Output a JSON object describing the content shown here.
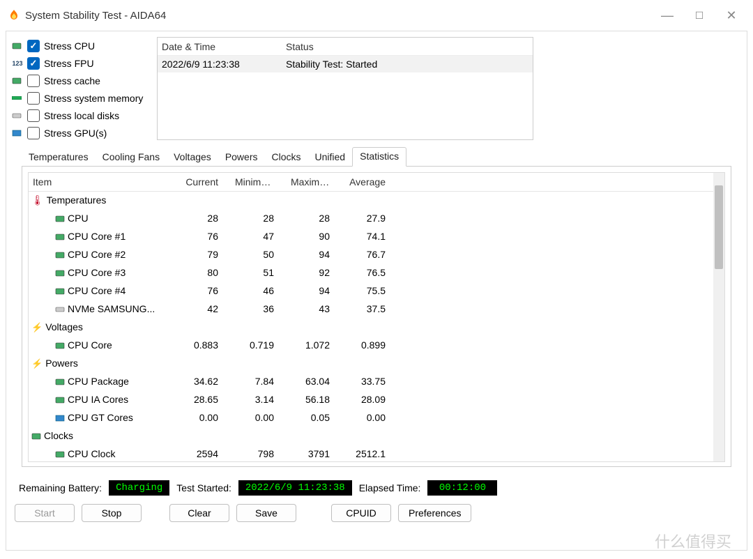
{
  "window": {
    "title": "System Stability Test - AIDA64"
  },
  "stress": [
    {
      "label": "Stress CPU",
      "checked": true,
      "icon": "chip"
    },
    {
      "label": "Stress FPU",
      "checked": true,
      "icon": "fpu"
    },
    {
      "label": "Stress cache",
      "checked": false,
      "icon": "chip"
    },
    {
      "label": "Stress system memory",
      "checked": false,
      "icon": "ram"
    },
    {
      "label": "Stress local disks",
      "checked": false,
      "icon": "disk"
    },
    {
      "label": "Stress GPU(s)",
      "checked": false,
      "icon": "gpu"
    }
  ],
  "log": {
    "headers": {
      "datetime": "Date & Time",
      "status": "Status"
    },
    "rows": [
      {
        "datetime": "2022/6/9 11:23:38",
        "status": "Stability Test: Started"
      }
    ]
  },
  "tabs": [
    "Temperatures",
    "Cooling Fans",
    "Voltages",
    "Powers",
    "Clocks",
    "Unified",
    "Statistics"
  ],
  "active_tab": "Statistics",
  "stats": {
    "headers": {
      "item": "Item",
      "current": "Current",
      "min": "Minimum",
      "max": "Maximu...",
      "avg": "Average"
    },
    "groups": [
      {
        "name": "Temperatures",
        "icon": "therm",
        "rows": [
          {
            "name": "CPU",
            "current": "28",
            "min": "28",
            "max": "28",
            "avg": "27.9",
            "icon": "chip"
          },
          {
            "name": "CPU Core #1",
            "current": "76",
            "min": "47",
            "max": "90",
            "avg": "74.1",
            "icon": "chip"
          },
          {
            "name": "CPU Core #2",
            "current": "79",
            "min": "50",
            "max": "94",
            "avg": "76.7",
            "icon": "chip"
          },
          {
            "name": "CPU Core #3",
            "current": "80",
            "min": "51",
            "max": "92",
            "avg": "76.5",
            "icon": "chip"
          },
          {
            "name": "CPU Core #4",
            "current": "76",
            "min": "46",
            "max": "94",
            "avg": "75.5",
            "icon": "chip"
          },
          {
            "name": "NVMe SAMSUNG...",
            "current": "42",
            "min": "36",
            "max": "43",
            "avg": "37.5",
            "icon": "disk"
          }
        ]
      },
      {
        "name": "Voltages",
        "icon": "bolt",
        "rows": [
          {
            "name": "CPU Core",
            "current": "0.883",
            "min": "0.719",
            "max": "1.072",
            "avg": "0.899",
            "icon": "chip"
          }
        ]
      },
      {
        "name": "Powers",
        "icon": "bolt",
        "rows": [
          {
            "name": "CPU Package",
            "current": "34.62",
            "min": "7.84",
            "max": "63.04",
            "avg": "33.75",
            "icon": "chip"
          },
          {
            "name": "CPU IA Cores",
            "current": "28.65",
            "min": "3.14",
            "max": "56.18",
            "avg": "28.09",
            "icon": "chip"
          },
          {
            "name": "CPU GT Cores",
            "current": "0.00",
            "min": "0.00",
            "max": "0.05",
            "avg": "0.00",
            "icon": "gpu"
          }
        ]
      },
      {
        "name": "Clocks",
        "icon": "chip",
        "rows": [
          {
            "name": "CPU Clock",
            "current": "2594",
            "min": "798",
            "max": "3791",
            "avg": "2512.1",
            "icon": "chip"
          }
        ]
      }
    ]
  },
  "status": {
    "battery_label": "Remaining Battery:",
    "battery_value": "Charging",
    "started_label": "Test Started:",
    "started_value": "2022/6/9 11:23:38",
    "elapsed_label": "Elapsed Time:",
    "elapsed_value": "00:12:00"
  },
  "buttons": {
    "start": "Start",
    "stop": "Stop",
    "clear": "Clear",
    "save": "Save",
    "cpuid": "CPUID",
    "prefs": "Preferences"
  },
  "watermark": "什么值得买"
}
